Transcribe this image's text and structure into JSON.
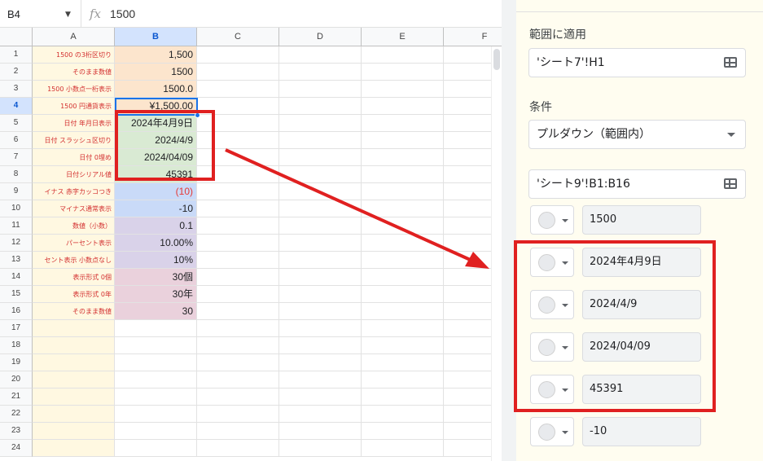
{
  "formula_bar": {
    "cell_ref": "B4",
    "fx": "fx",
    "value": "1500"
  },
  "columns": [
    "A",
    "B",
    "C",
    "D",
    "E",
    "F"
  ],
  "rows": [
    {
      "num": "1",
      "a": "1500 の3桁区切り",
      "b": "1,500",
      "color": "peach"
    },
    {
      "num": "2",
      "a": "そのまま数値",
      "b": "1500",
      "color": "peach"
    },
    {
      "num": "3",
      "a": "1500 小数点一桁表示",
      "b": "1500.0",
      "color": "peach"
    },
    {
      "num": "4",
      "a": "1500 円通貨表示",
      "b": "¥1,500.00",
      "color": "peach"
    },
    {
      "num": "5",
      "a": "日付 年月日表示",
      "b": "2024年4月9日",
      "color": "green"
    },
    {
      "num": "6",
      "a": "日付 スラッシュ区切り",
      "b": "2024/4/9",
      "color": "green"
    },
    {
      "num": "7",
      "a": "日付 0埋め",
      "b": "2024/04/09",
      "color": "green"
    },
    {
      "num": "8",
      "a": "日付シリアル値",
      "b": "45391",
      "color": "green"
    },
    {
      "num": "9",
      "a": "イナス 赤字カッコつき",
      "b": "(10)",
      "color": "blue",
      "neg": true
    },
    {
      "num": "10",
      "a": "マイナス通常表示",
      "b": "-10",
      "color": "blue"
    },
    {
      "num": "11",
      "a": "数値（小数）",
      "b": "0.1",
      "color": "lav"
    },
    {
      "num": "12",
      "a": "パーセント表示",
      "b": "10.00%",
      "color": "lav"
    },
    {
      "num": "13",
      "a": "セント表示 小数点なし",
      "b": "10%",
      "color": "lav"
    },
    {
      "num": "14",
      "a": "表示形式 0個",
      "b": "30個",
      "color": "pink"
    },
    {
      "num": "15",
      "a": "表示形式 0年",
      "b": "30年",
      "color": "pink"
    },
    {
      "num": "16",
      "a": "そのまま数値",
      "b": "30",
      "color": "pink"
    },
    {
      "num": "17",
      "a": "",
      "b": "",
      "color": ""
    },
    {
      "num": "18",
      "a": "",
      "b": "",
      "color": ""
    },
    {
      "num": "19",
      "a": "",
      "b": "",
      "color": ""
    },
    {
      "num": "20",
      "a": "",
      "b": "",
      "color": ""
    },
    {
      "num": "21",
      "a": "",
      "b": "",
      "color": ""
    },
    {
      "num": "22",
      "a": "",
      "b": "",
      "color": ""
    },
    {
      "num": "23",
      "a": "",
      "b": "",
      "color": ""
    },
    {
      "num": "24",
      "a": "",
      "b": "",
      "color": ""
    }
  ],
  "panel": {
    "apply_range_label": "範囲に適用",
    "apply_range_value": "'シート7'!H1",
    "condition_label": "条件",
    "condition_value": "プルダウン（範囲内）",
    "source_range_value": "'シート9'!B1:B16",
    "options": [
      "1500",
      "2024年4月9日",
      "2024/4/9",
      "2024/04/09",
      "45391",
      "-10"
    ]
  },
  "colors": {
    "annotation_red": "#e02020",
    "selection_blue": "#1a73e8"
  }
}
